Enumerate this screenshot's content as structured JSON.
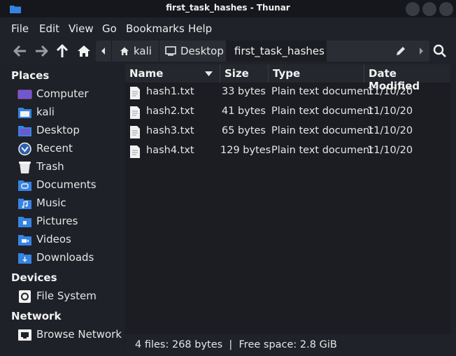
{
  "window": {
    "title": "first_task_hashes - Thunar"
  },
  "menubar": {
    "items": [
      "File",
      "Edit",
      "View",
      "Go",
      "Bookmarks",
      "Help"
    ]
  },
  "pathbar": {
    "crumbs": [
      "kali",
      "Desktop",
      "first_task_hashes"
    ]
  },
  "sidebar": {
    "places_title": "Places",
    "places": [
      {
        "label": "Computer",
        "icon": "computer-icon"
      },
      {
        "label": "kali",
        "icon": "home-folder-icon"
      },
      {
        "label": "Desktop",
        "icon": "desktop-folder-icon"
      },
      {
        "label": "Recent",
        "icon": "recent-icon"
      },
      {
        "label": "Trash",
        "icon": "trash-icon"
      },
      {
        "label": "Documents",
        "icon": "documents-folder-icon"
      },
      {
        "label": "Music",
        "icon": "music-folder-icon"
      },
      {
        "label": "Pictures",
        "icon": "pictures-folder-icon"
      },
      {
        "label": "Videos",
        "icon": "videos-folder-icon"
      },
      {
        "label": "Downloads",
        "icon": "downloads-folder-icon"
      }
    ],
    "devices_title": "Devices",
    "devices": [
      {
        "label": "File System",
        "icon": "drive-icon"
      }
    ],
    "network_title": "Network",
    "network": [
      {
        "label": "Browse Network",
        "icon": "network-icon"
      }
    ]
  },
  "table": {
    "columns": [
      "Name",
      "Size",
      "Type",
      "Date Modified"
    ],
    "rows": [
      {
        "name": "hash1.txt",
        "size": "33 bytes",
        "type": "Plain text document",
        "date": "11/10/20"
      },
      {
        "name": "hash2.txt",
        "size": "41 bytes",
        "type": "Plain text document",
        "date": "11/10/20"
      },
      {
        "name": "hash3.txt",
        "size": "65 bytes",
        "type": "Plain text document",
        "date": "11/10/20"
      },
      {
        "name": "hash4.txt",
        "size": "129 bytes",
        "type": "Plain text document",
        "date": "11/10/20"
      }
    ]
  },
  "status": {
    "text": "4 files: 268 bytes  |  Free space: 2.8 GiB"
  },
  "colors": {
    "accent": "#3584e4",
    "background": "#1b1d23",
    "panel": "#202229"
  }
}
